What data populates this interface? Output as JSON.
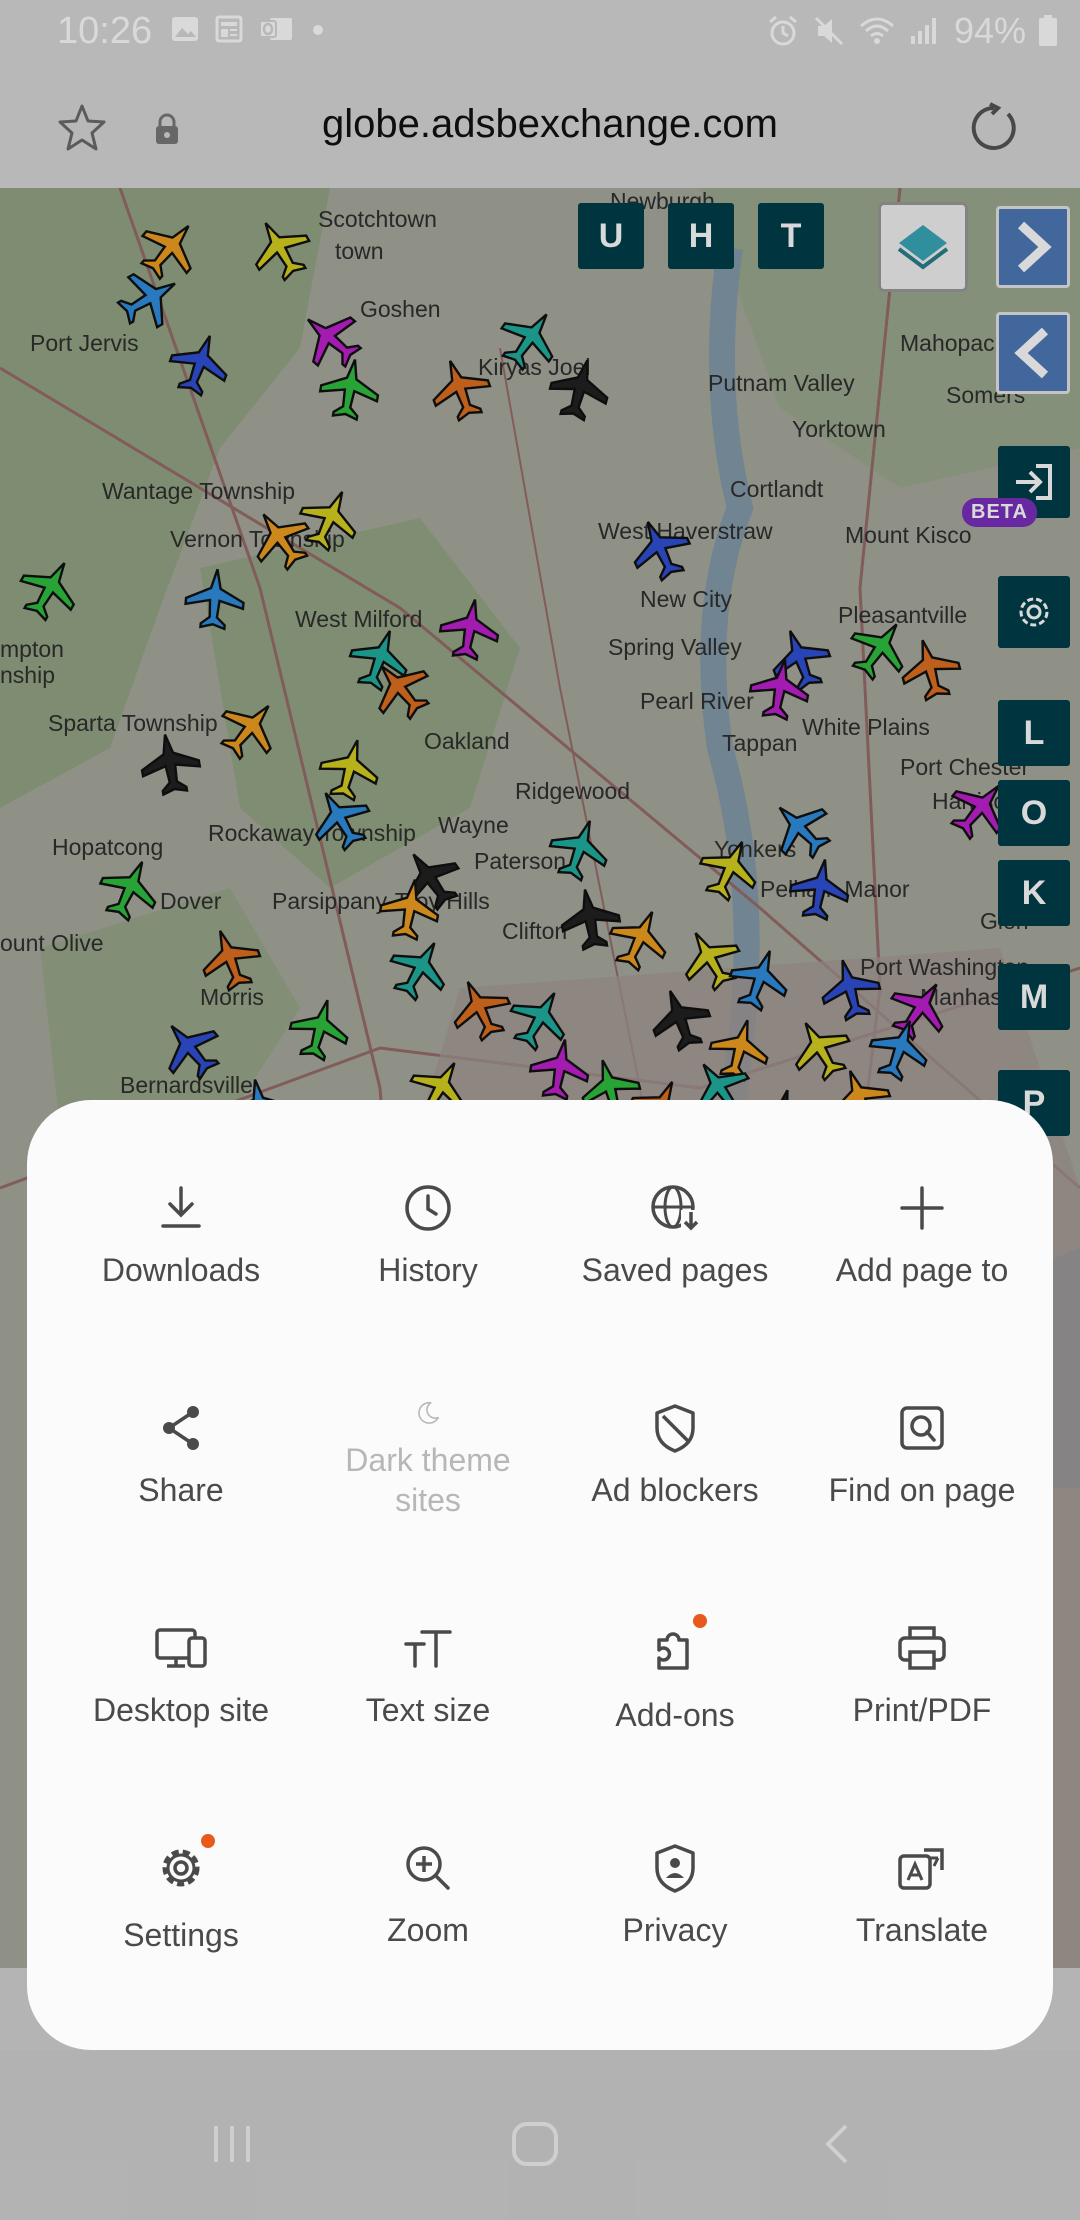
{
  "status_bar": {
    "time": "10:26",
    "battery": "94%",
    "icons": [
      "image-icon",
      "news-icon",
      "outlook-icon",
      "dot-icon",
      "alarm-icon",
      "mute-icon",
      "wifi-icon",
      "signal-icon",
      "battery-icon"
    ]
  },
  "browser": {
    "url": "globe.adsbexchange.com",
    "icons": [
      "star-icon",
      "lock-icon",
      "reload-icon"
    ]
  },
  "map": {
    "place_labels": [
      "Newburgh",
      "Scotchtown",
      "town",
      "Goshen",
      "Port Jervis",
      "Kiryas Joel",
      "Mahopac",
      "Putnam Valley",
      "Somers",
      "Yorktown",
      "Wantage Township",
      "Cortlandt",
      "Vernon Township",
      "West Haverstraw",
      "Mount Kisco",
      "New City",
      "West Milford",
      "Spring Valley",
      "Pleasantville",
      "mpton",
      "nship",
      "Pearl River",
      "White Plains",
      "Sparta Township",
      "Oakland",
      "Tappan",
      "Port Chester",
      "Ridgewood",
      "Harrison",
      "Wayne",
      "Rockaway Township",
      "Hopatcong",
      "Paterson",
      "Yonkers",
      "Dover",
      "Parsippany-Troy Hills",
      "Pelham Manor",
      "Glen",
      "ount Olive",
      "Clifton",
      "Port Washington",
      "Morris",
      "Manhasset",
      "Bernardsville"
    ],
    "left_controls": [
      "U",
      "H",
      "T"
    ],
    "right_controls": [
      "L",
      "O",
      "K",
      "M",
      "P"
    ],
    "beta_label": "BETA"
  },
  "menu": {
    "items": [
      {
        "label": "Downloads",
        "icon": "download-icon"
      },
      {
        "label": "History",
        "icon": "clock-icon"
      },
      {
        "label": "Saved pages",
        "icon": "saved-pages-icon"
      },
      {
        "label": "Add page to",
        "icon": "plus-icon"
      },
      {
        "label": "Share",
        "icon": "share-icon"
      },
      {
        "label": "Dark theme sites",
        "icon": "moon-icon",
        "disabled": true
      },
      {
        "label": "Ad blockers",
        "icon": "shield-icon"
      },
      {
        "label": "Find on page",
        "icon": "find-icon"
      },
      {
        "label": "Desktop site",
        "icon": "desktop-icon"
      },
      {
        "label": "Text size",
        "icon": "text-size-icon"
      },
      {
        "label": "Add-ons",
        "icon": "puzzle-icon",
        "badge": true
      },
      {
        "label": "Print/PDF",
        "icon": "printer-icon"
      },
      {
        "label": "Settings",
        "icon": "gear-icon",
        "badge": true
      },
      {
        "label": "Zoom",
        "icon": "zoom-icon"
      },
      {
        "label": "Privacy",
        "icon": "privacy-icon"
      },
      {
        "label": "Translate",
        "icon": "translate-icon"
      }
    ],
    "badge_color": "#e85a1b"
  },
  "system_nav": {
    "icons": [
      "recents-icon",
      "home-icon",
      "back-icon"
    ]
  },
  "colors": {
    "control_bg": "#003f4a",
    "nav_arrow_bg": "#4d79b8",
    "beta_bg": "#7b2fbf",
    "sheet_bg": "#fbfbfb"
  }
}
